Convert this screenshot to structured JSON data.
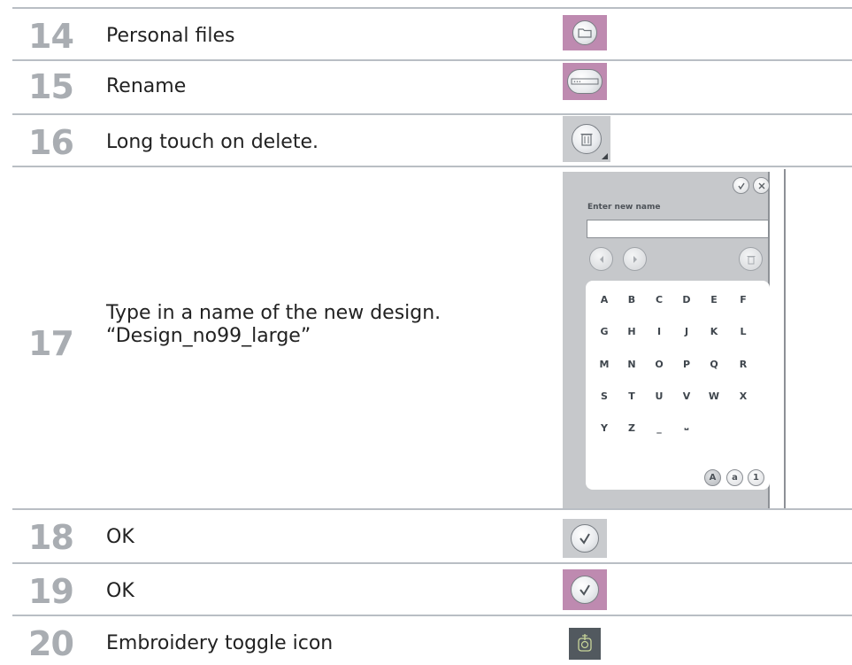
{
  "rows": [
    {
      "num": "14",
      "text": "Personal files",
      "icon": "folder-icon"
    },
    {
      "num": "15",
      "text": "Rename",
      "icon": "rename-icon"
    },
    {
      "num": "16",
      "text": "Long touch on delete.",
      "icon": "trash-icon"
    },
    {
      "num": "17",
      "text_line1": "Type in a name of the new design.",
      "text_line2": "“Design_no99_large”"
    },
    {
      "num": "18",
      "text": "OK",
      "icon": "checkmark-icon"
    },
    {
      "num": "19",
      "text": "OK",
      "icon": "checkmark-icon"
    },
    {
      "num": "20",
      "text": "Embroidery toggle icon",
      "icon": "embroidery-icon"
    }
  ],
  "keyboard": {
    "label": "Enter new name",
    "input_value": "",
    "rows": [
      [
        "A",
        "B",
        "C",
        "D",
        "E",
        "F"
      ],
      [
        "G",
        "H",
        "I",
        "J",
        "K",
        "L"
      ],
      [
        "M",
        "N",
        "O",
        "P",
        "Q",
        "R"
      ],
      [
        "S",
        "T",
        "U",
        "V",
        "W",
        "X"
      ],
      [
        "Y",
        "Z",
        "_",
        "⎵"
      ]
    ],
    "modes": [
      "A",
      "a",
      "1"
    ],
    "active_mode": "A"
  },
  "colors": {
    "pink_highlight": "#be8ab0",
    "grey_highlight": "#c9cbce",
    "number_grey": "#a9adb2",
    "rule_grey": "#b9bec4"
  }
}
